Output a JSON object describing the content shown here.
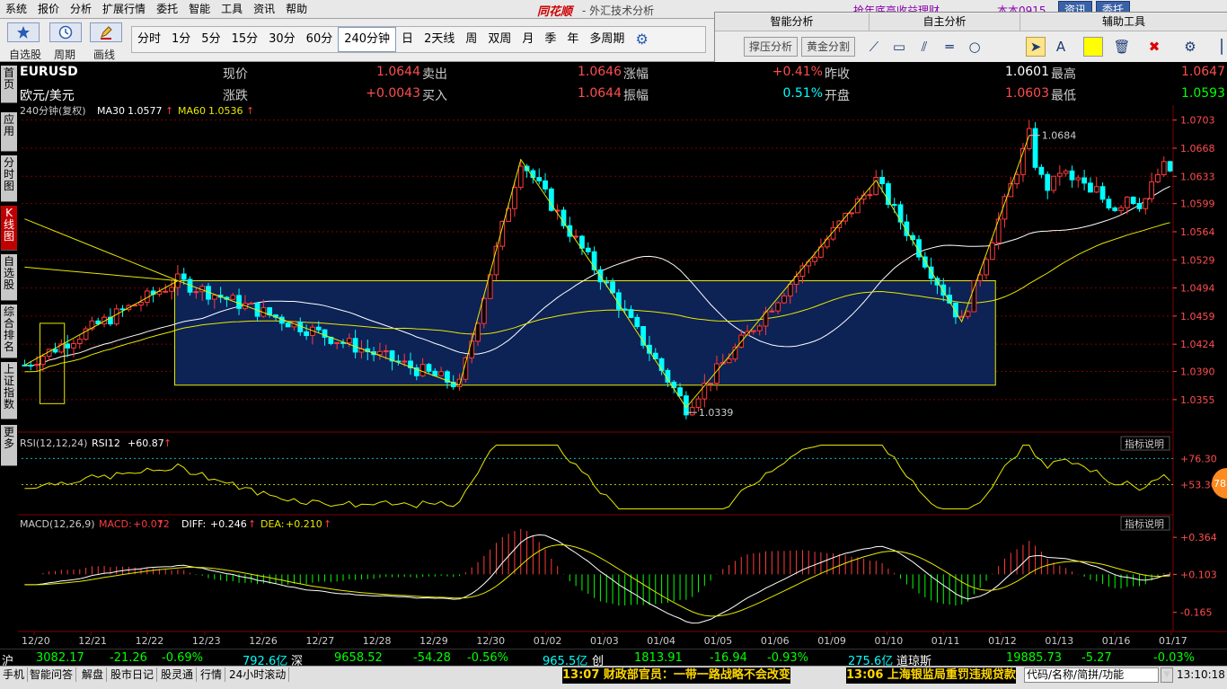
{
  "menu": [
    "系统",
    "报价",
    "分析",
    "扩展行情",
    "委托",
    "智能",
    "工具",
    "资讯",
    "帮助"
  ],
  "app": {
    "title": "同花顺",
    "subtitle": "- 外汇技术分析",
    "promo": "抢年底高收益理财",
    "promo2": "本本0915",
    "btn_info": "资讯",
    "btn_trade": "委托"
  },
  "toolbar": {
    "icons": [
      {
        "label": "自选股",
        "icon": "star-icon"
      },
      {
        "label": "周期",
        "icon": "clock-icon"
      },
      {
        "label": "画线",
        "icon": "pen-icon"
      }
    ],
    "periods": [
      "分时",
      "1分",
      "5分",
      "15分",
      "30分",
      "60分",
      "240分钟",
      "日",
      "2天线",
      "周",
      "双周",
      "月",
      "季",
      "年",
      "多周期"
    ],
    "active_period": "240分钟"
  },
  "right_panel": {
    "tabs": [
      "智能分析",
      "自主分析",
      "辅助工具"
    ],
    "smart_buttons": [
      "撑压分析",
      "黄金分割"
    ]
  },
  "sidebar": [
    "首页",
    "应用",
    "分时图",
    "K线图",
    "自选股",
    "综合排名",
    "上证指数",
    "更多"
  ],
  "quote": {
    "symbol": "EURUSD",
    "name": "欧元/美元",
    "row1": [
      {
        "label": "现价",
        "value": "1.0644"
      },
      {
        "label": "卖出",
        "value": "1.0646"
      },
      {
        "label": "涨幅",
        "value": "+0.41%"
      },
      {
        "label": "昨收",
        "value": "1.0601"
      },
      {
        "label": "最高",
        "value": "1.0647"
      }
    ],
    "row2": [
      {
        "label": "涨跌",
        "value": "+0.0043"
      },
      {
        "label": "买入",
        "value": "1.0644"
      },
      {
        "label": "振幅",
        "value": "0.51%"
      },
      {
        "label": "开盘",
        "value": "1.0603"
      },
      {
        "label": "最低",
        "value": "1.0593"
      }
    ]
  },
  "chart_data": {
    "type": "candlestick",
    "period_label": "240分钟(复权)",
    "ma_labels": [
      {
        "name": "MA30",
        "value": "1.0577"
      },
      {
        "name": "MA60",
        "value": "1.0536"
      }
    ],
    "y_ticks": [
      "1.0703",
      "1.0668",
      "1.0633",
      "1.0599",
      "1.0564",
      "1.0529",
      "1.0494",
      "1.0459",
      "1.0424",
      "1.0390",
      "1.0355"
    ],
    "ylim": [
      1.0328,
      1.0706
    ],
    "x_labels": [
      "12/20",
      "12/21",
      "12/22",
      "12/23",
      "12/26",
      "12/27",
      "12/28",
      "12/29",
      "12/30",
      "01/02",
      "01/03",
      "01/04",
      "01/05",
      "01/06",
      "01/09",
      "01/10",
      "01/11",
      "01/12",
      "01/13",
      "01/16",
      "01/17"
    ],
    "annotations": [
      {
        "text": "1.0684",
        "value": 1.0684
      },
      {
        "text": "1.0339",
        "value": 1.0339
      }
    ],
    "zigzag": [
      [
        0,
        1.0398
      ],
      [
        25,
        1.0503
      ],
      [
        71,
        1.0373
      ],
      [
        81,
        1.0654
      ],
      [
        96,
        1.0486
      ],
      [
        108,
        1.0345
      ],
      [
        139,
        1.0628
      ],
      [
        153,
        1.0452
      ],
      [
        164,
        1.0684
      ]
    ],
    "box1": {
      "x_from": 3,
      "x_to": 6,
      "y_top": 1.045,
      "y_bottom": 1.035
    },
    "box2": {
      "x_from": 25,
      "x_to": 158,
      "y_top": 1.0503,
      "y_bottom": 1.0373
    },
    "rsi": {
      "label": "RSI(12,12,24)",
      "name": "RSI12",
      "value": "+60.87",
      "ticks": [
        "76.30",
        "53.30"
      ],
      "button": "指标说明"
    },
    "macd": {
      "label": "MACD(12,26,9)",
      "macd": "+0.072",
      "diff": "+0.246",
      "dea": "+0.210",
      "ticks": [
        "0.364",
        "0.103",
        "-0.165"
      ],
      "button": "指标说明"
    },
    "badge": "78"
  },
  "status": {
    "sh": {
      "name": "沪",
      "value": "3082.17",
      "change": "-21.26",
      "pct": "-0.69%",
      "amount": "792.6亿"
    },
    "sz": {
      "name": "深",
      "value": "9658.52",
      "change": "-54.28",
      "pct": "-0.56%",
      "amount": "965.5亿"
    },
    "cy": {
      "name": "创",
      "value": "1813.91",
      "change": "-16.94",
      "pct": "-0.93%",
      "amount": "275.6亿"
    },
    "dj": {
      "name": "道琼斯",
      "value": "19885.73",
      "change": "-5.27",
      "pct": "-0.03%"
    }
  },
  "taskbar": {
    "items": [
      "手机",
      "智能问答",
      "解盘",
      "股市日记",
      "股灵通",
      "行情",
      "24小时滚动"
    ],
    "news1": "13:07 财政部官员：一带一路战略不会改变",
    "news2": "13:06 上海银监局重罚违规贷款",
    "search": "代码/名称/简拼/功能",
    "clock": "13:10:18"
  },
  "colors": {
    "up": "#ff3b3b",
    "down": "#00ffff",
    "ma30": "#ffffff",
    "ma60": "#e8e800",
    "grid": "#800000",
    "box": "#0d2255"
  }
}
